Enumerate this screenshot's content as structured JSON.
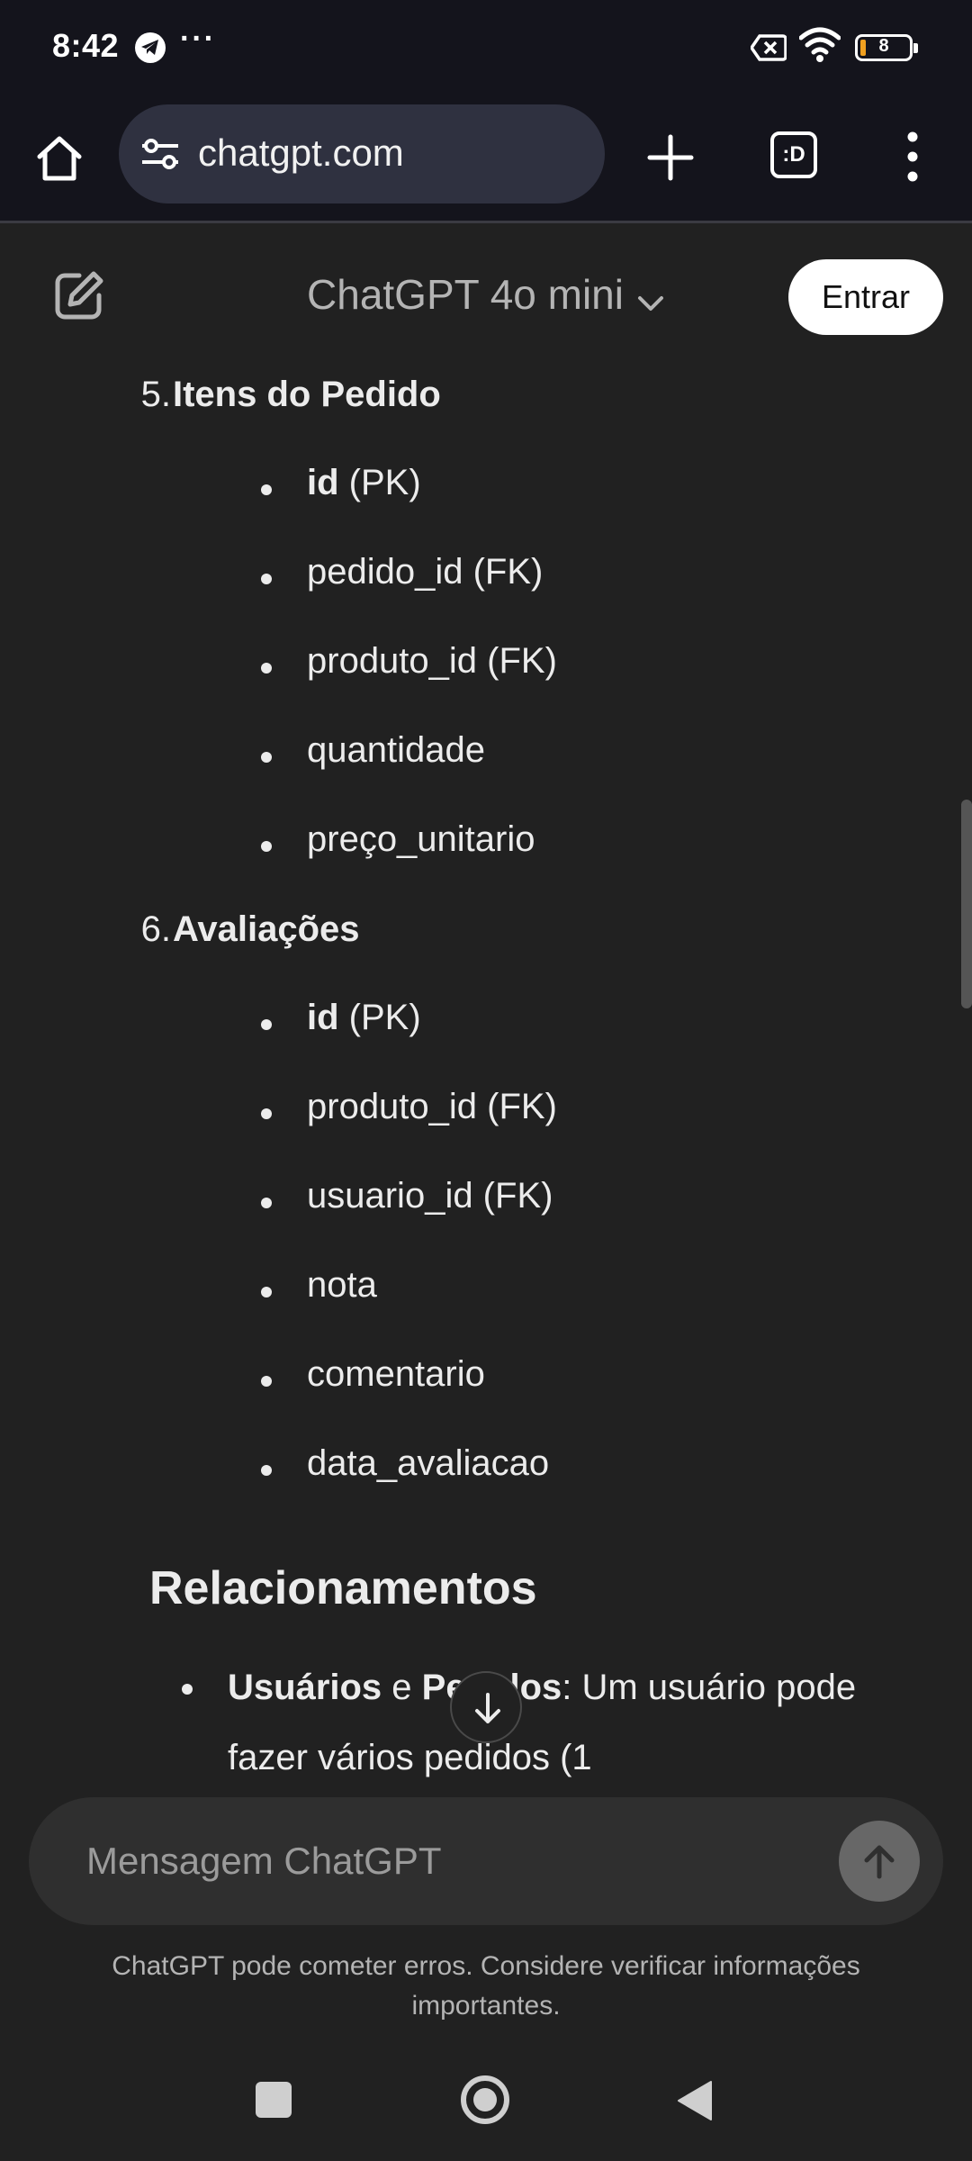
{
  "status_bar": {
    "time": "8:42",
    "overflow": "···",
    "battery": "8",
    "icons": [
      "telegram-icon",
      "xbox-icon",
      "wifi-icon",
      "battery-icon"
    ]
  },
  "browser": {
    "url": "chatgpt.com",
    "tab_count_label": ":D",
    "icons": [
      "home-icon",
      "site-settings-icon",
      "plus-icon",
      "tabs-icon",
      "more-vert-icon"
    ]
  },
  "chat_header": {
    "model": "ChatGPT 4o mini",
    "login_label": "Entrar",
    "icons": [
      "edit-icon",
      "chevron-down-icon"
    ]
  },
  "content": {
    "lists": [
      {
        "number": "5.",
        "title": "Itens do Pedido",
        "items": [
          {
            "bold": "id",
            "rest": " (PK)"
          },
          {
            "bold": "",
            "rest": "pedido_id (FK)"
          },
          {
            "bold": "",
            "rest": "produto_id (FK)"
          },
          {
            "bold": "",
            "rest": "quantidade"
          },
          {
            "bold": "",
            "rest": "preço_unitario"
          }
        ]
      },
      {
        "number": "6.",
        "title": "Avaliações",
        "items": [
          {
            "bold": "id",
            "rest": " (PK)"
          },
          {
            "bold": "",
            "rest": "produto_id (FK)"
          },
          {
            "bold": "",
            "rest": "usuario_id (FK)"
          },
          {
            "bold": "",
            "rest": "nota"
          },
          {
            "bold": "",
            "rest": "comentario"
          },
          {
            "bold": "",
            "rest": "data_avaliacao"
          }
        ]
      }
    ],
    "section_heading": "Relacionamentos",
    "relationship": {
      "bold1": "Usuários",
      "mid": " e ",
      "bold2": "Pedidos",
      "rest": ": Um usuário pode fazer vários pedidos (1"
    }
  },
  "composer": {
    "placeholder": "Mensagem ChatGPT",
    "disclaimer": "ChatGPT pode cometer erros. Considere verificar informações importantes."
  },
  "colors": {
    "background": "#212121",
    "toolbar": "#14141c",
    "url_box": "#2f3140",
    "composer": "#2f2f2f",
    "text": "#ececec",
    "muted": "#b4b4b4",
    "battery_low": "#f0a020"
  }
}
